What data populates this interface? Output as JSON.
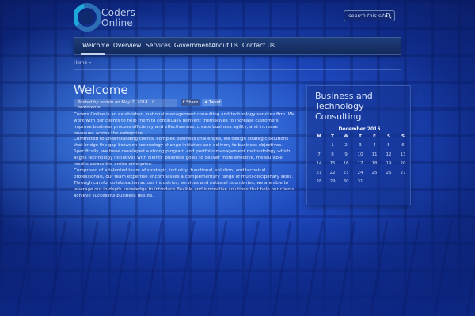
{
  "header": {
    "logo_line1": "Coders",
    "logo_line2": "Online",
    "search_placeholder": "search this site..."
  },
  "nav": {
    "items": [
      "Welcome",
      "Overview",
      "Services",
      "Government",
      "About Us",
      "Contact Us"
    ],
    "active": "Welcome"
  },
  "breadcrumb": "Home »",
  "main": {
    "title": "Welcome",
    "meta": "Posted by admin on May 7, 2014 | 0 comments",
    "share_label": "Share",
    "tweet_label": "Tweet",
    "paragraphs": [
      "Coders Online is an established, national management consulting and technology services firm. We work with our clients to help them to continually reinvent themselves to increase customers, improve business process efficiency and effectiveness, create business agility, and increase revenues across the enterprise.",
      "Committed to understanding clients' complex business challenges, we design strategic solutions that bridge the gap between technology change initiation and delivery to business objectives. Specifically, we have developed a strong program and portfolio management methodology which aligns technology initiatives with clients' business goals to deliver more effective, measurable results across the entire enterprise.",
      "Comprised of a talented team of strategic, industry, functional, solution, and technical professionals, our team expertise encompasses a complementary range of multi-disciplinary skills. Through careful collaboration across industries, services and national boundaries, we are able to leverage our in-depth knowledge to introduce flexible and innovative solutions that help our clients achieve successful business results."
    ]
  },
  "sidebar": {
    "widget_title": "Business and Technology Consulting",
    "calendar": {
      "caption": "December 2015",
      "weekdays": [
        "M",
        "T",
        "W",
        "T",
        "F",
        "S",
        "S"
      ],
      "weeks": [
        [
          "",
          "1",
          "2",
          "3",
          "4",
          "5",
          "6"
        ],
        [
          "7",
          "8",
          "9",
          "10",
          "11",
          "12",
          "13"
        ],
        [
          "14",
          "15",
          "16",
          "17",
          "18",
          "19",
          "20"
        ],
        [
          "21",
          "22",
          "23",
          "24",
          "25",
          "26",
          "27"
        ],
        [
          "28",
          "29",
          "30",
          "31",
          "",
          "",
          ""
        ]
      ]
    }
  },
  "colors": {
    "nav_bg": "#132a5c",
    "accent": "#2e63d6",
    "text": "#e2ebff"
  }
}
